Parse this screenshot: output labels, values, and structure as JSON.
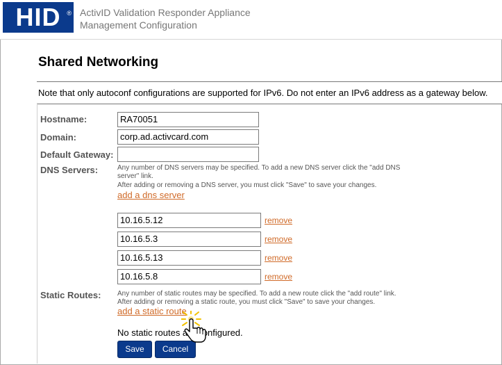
{
  "header": {
    "logo_text": "HID",
    "logo_mark": "®",
    "title_line1": "ActivID Validation Responder Appliance",
    "title_line2": "Management Configuration"
  },
  "page": {
    "title": "Shared Networking",
    "note": "Note that only autoconf configurations are supported for IPv6. Do not enter an IPv6 address as a gateway below."
  },
  "form": {
    "hostname": {
      "label": "Hostname:",
      "value": "RA70051"
    },
    "domain": {
      "label": "Domain:",
      "value": "corp.ad.activcard.com"
    },
    "gateway": {
      "label": "Default Gateway:",
      "value": ""
    },
    "dns": {
      "label": "DNS Servers:",
      "help_line1": "Any number of DNS servers may be specified. To add a new DNS server click the \"add DNS",
      "help_line2": "server\" link.",
      "help_line3": "After adding or removing a DNS server, you must click \"Save\" to save your changes.",
      "add_link": "add a dns server",
      "remove_label": "remove",
      "servers": [
        "10.16.5.12",
        "10.16.5.3",
        "10.16.5.13",
        "10.16.5.8"
      ]
    },
    "routes": {
      "label": "Static Routes:",
      "help_line1": "Any number of static routes may be specified. To add a new route click the \"add route\" link.",
      "help_line2": "After adding or removing a static route, you must click \"Save\" to save your changes.",
      "add_link": "add a static route",
      "status": "No static routes are configured."
    }
  },
  "buttons": {
    "save": "Save",
    "cancel": "Cancel"
  },
  "colors": {
    "brand": "#0b3a8c",
    "link": "#d06a28"
  },
  "icons": {
    "cursor": "hand-pointer-icon"
  }
}
